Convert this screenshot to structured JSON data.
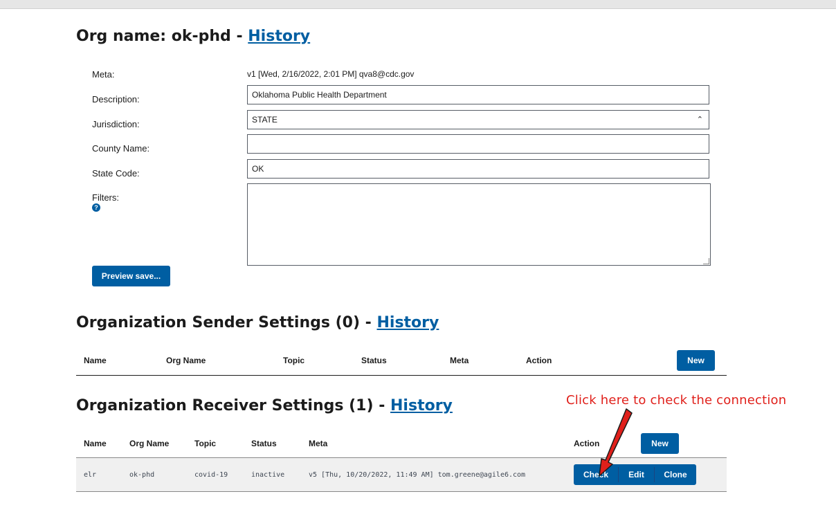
{
  "org": {
    "heading_prefix": "Org name: ok-phd -",
    "history_link": "History"
  },
  "form": {
    "meta_label": "Meta:",
    "meta_value": "v1 [Wed, 2/16/2022, 2:01 PM] qva8@cdc.gov",
    "description_label": "Description:",
    "description_value": "Oklahoma Public Health Department",
    "jurisdiction_label": "Jurisdiction:",
    "jurisdiction_value": "STATE",
    "county_label": "County Name:",
    "county_value": "",
    "state_code_label": "State Code:",
    "state_code_value": "OK",
    "filters_label": "Filters:",
    "help_icon": "?",
    "preview_button": "Preview save..."
  },
  "senders": {
    "heading_prefix": "Organization Sender Settings (0) -",
    "history_link": "History",
    "columns": [
      "Name",
      "Org Name",
      "Topic",
      "Status",
      "Meta",
      "Action"
    ],
    "new_button": "New"
  },
  "receivers": {
    "heading_prefix": "Organization Receiver Settings (1) -",
    "history_link": "History",
    "columns": [
      "Name",
      "Org Name",
      "Topic",
      "Status",
      "Meta",
      "Action"
    ],
    "new_button": "New",
    "rows": [
      {
        "name": "elr",
        "org_name": "ok-phd",
        "topic": "covid-19",
        "status": "inactive",
        "meta": "v5 [Thu, 10/20/2022, 11:49 AM] tom.greene@agile6.com",
        "actions": [
          "Check",
          "Edit",
          "Clone"
        ]
      }
    ]
  },
  "annotation": {
    "text": "Click here to check the connection",
    "color": "#e0201b"
  },
  "colors": {
    "primary": "#005ea2",
    "link": "#005ea2"
  }
}
